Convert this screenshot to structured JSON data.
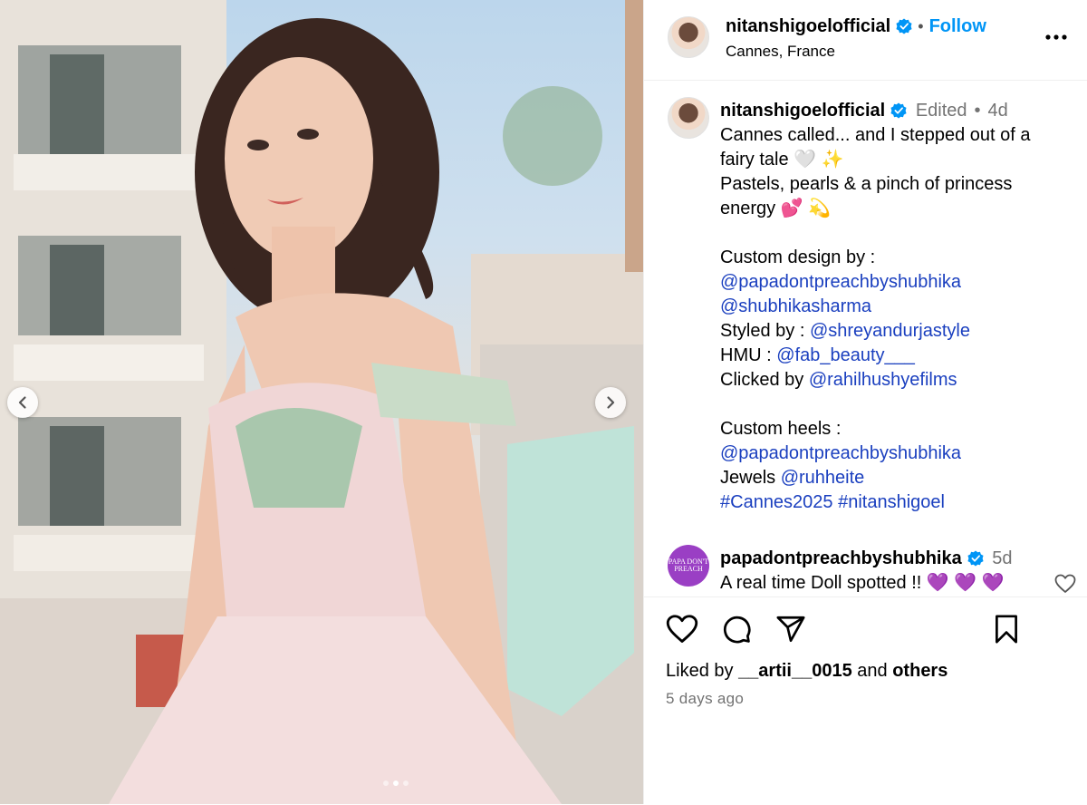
{
  "post": {
    "author": "nitanshigoelofficial",
    "location": "Cannes, France",
    "follow_label": "Follow",
    "separator": "•"
  },
  "caption": {
    "author": "nitanshigoelofficial",
    "edited": "Edited",
    "dot": "•",
    "age": "4d",
    "lines": [
      {
        "text": "Cannes called... and I stepped out of a",
        "kind": "text"
      },
      {
        "text": "fairy tale 🤍 ✨",
        "kind": "text"
      },
      {
        "text": "Pastels, pearls & a pinch of princess",
        "kind": "text"
      },
      {
        "text": "energy 💕 💫",
        "kind": "text"
      },
      {
        "text": "",
        "kind": "blank"
      },
      {
        "text": "Custom design by :",
        "kind": "text"
      },
      {
        "text": "@papadontpreachbyshubhika",
        "kind": "link"
      },
      {
        "text": "@shubhikasharma",
        "kind": "link"
      },
      {
        "prefix": "Styled by : ",
        "link": "@shreyandurjastyle",
        "kind": "mixed"
      },
      {
        "prefix": "HMU : ",
        "link": "@fab_beauty___",
        "kind": "mixed"
      },
      {
        "prefix": "Clicked by ",
        "link": "@rahilhushyefilms",
        "kind": "mixed"
      },
      {
        "text": "",
        "kind": "blank"
      },
      {
        "text": "Custom heels :",
        "kind": "text"
      },
      {
        "text": "@papadontpreachbyshubhika",
        "kind": "link"
      },
      {
        "prefix": "Jewels ",
        "link": "@ruhheite",
        "kind": "mixed"
      },
      {
        "text": "#Cannes2025 #nitanshigoel",
        "kind": "link"
      }
    ]
  },
  "comment": {
    "author": "papadontpreachbyshubhika",
    "age": "5d",
    "text": "A real time Doll spotted !! 💜 💜 💜",
    "avatar_text": "PAPA DON'T PREACH"
  },
  "footer": {
    "liked_by_prefix": "Liked by ",
    "liked_by_user": "__artii__0015",
    "liked_by_mid": " and ",
    "liked_by_others": "others",
    "timestamp": "5 days ago"
  },
  "carousel": {
    "slide_count": 3,
    "active_slide": 1
  },
  "colors": {
    "accent": "#0095f6",
    "verified": "#0095f6",
    "link": "#1a3fbf",
    "muted": "#737373"
  },
  "icons": [
    "chevron-left-icon",
    "chevron-right-icon",
    "verified-badge-icon",
    "more-icon",
    "heart-icon",
    "comment-icon",
    "share-icon",
    "save-icon"
  ]
}
